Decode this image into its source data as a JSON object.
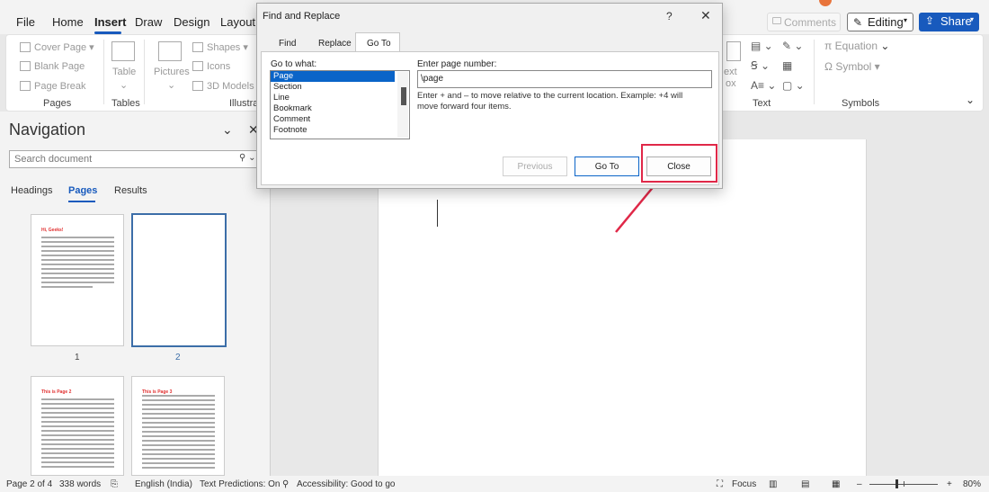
{
  "menu": {
    "items": [
      "File",
      "Home",
      "Insert",
      "Draw",
      "Design",
      "Layout"
    ],
    "active": "Insert",
    "comments": "Comments",
    "editing": "Editing",
    "share": "Share"
  },
  "ribbon": {
    "pages_group": {
      "cover_page": "Cover Page",
      "blank_page": "Blank Page",
      "page_break": "Page Break",
      "label": "Pages"
    },
    "tables_group": {
      "table": "Table",
      "label": "Tables"
    },
    "illustrations_group": {
      "pictures": "Pictures",
      "shapes": "Shapes",
      "icons": "Icons",
      "models": "3D Models",
      "label": "Illustrati"
    },
    "text_group": {
      "label": "Text",
      "text_partial": "ext",
      "box_partial": "ox"
    },
    "symbols_group": {
      "equation": "Equation",
      "symbol": "Symbol",
      "label": "Symbols"
    }
  },
  "navigation": {
    "title": "Navigation",
    "search_placeholder": "Search document",
    "tabs": [
      "Headings",
      "Pages",
      "Results"
    ],
    "active_tab": "Pages",
    "pages": [
      {
        "num": "1",
        "heading": "Hi, Geeks!"
      },
      {
        "num": "2",
        "heading": ""
      },
      {
        "num": "",
        "heading": "This is Page 2"
      },
      {
        "num": "",
        "heading": "This is Page 3"
      }
    ]
  },
  "dialog": {
    "title": "Find and Replace",
    "help": "?",
    "close_x": "✕",
    "tabs": [
      "Find",
      "Replace",
      "Go To"
    ],
    "active_tab": "Go To",
    "goto_label": "Go to what:",
    "goto_items": [
      "Page",
      "Section",
      "Line",
      "Bookmark",
      "Comment",
      "Footnote"
    ],
    "selected_item": "Page",
    "enter_label": "Enter page number:",
    "page_value": "\\page",
    "hint": "Enter + and – to move relative to the current location. Example: +4 will move forward four items.",
    "buttons": {
      "previous": "Previous",
      "goto": "Go To",
      "close": "Close"
    }
  },
  "status": {
    "page": "Page 2 of 4",
    "words": "338 words",
    "language": "English (India)",
    "predictions": "Text Predictions: On",
    "accessibility": "Accessibility: Good to go",
    "focus": "Focus",
    "zoom": "80%",
    "zoom_minus": "–",
    "zoom_plus": "+",
    "zoom_level": 0.4
  },
  "colors": {
    "accent": "#185abd",
    "annotation": "#e02848",
    "selection": "#0a64c8"
  }
}
